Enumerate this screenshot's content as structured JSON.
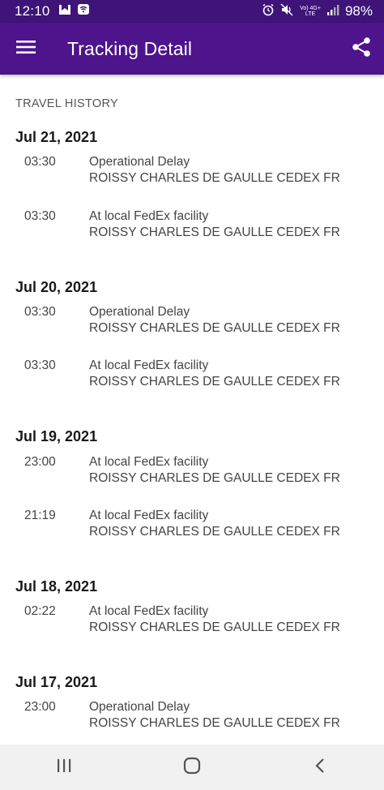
{
  "status_bar": {
    "time": "12:10",
    "network_label_top": "Vo) 4G+",
    "network_label_bottom": "LTE",
    "battery": "98%",
    "icons": [
      "mailbox-icon",
      "wifi-box-icon",
      "alarm-icon",
      "mute-icon",
      "signal-icon"
    ]
  },
  "app_bar": {
    "title": "Tracking Detail",
    "background": "#4d148c",
    "icons": [
      "menu-icon",
      "share-icon"
    ]
  },
  "travel_history": {
    "heading": "TRAVEL HISTORY",
    "days": [
      {
        "date": "Jul 21, 2021",
        "events": [
          {
            "time": "03:30",
            "status": "Operational Delay",
            "location": "ROISSY CHARLES DE GAULLE CEDEX FR"
          },
          {
            "time": "03:30",
            "status": "At local FedEx facility",
            "location": "ROISSY CHARLES DE GAULLE CEDEX FR"
          }
        ]
      },
      {
        "date": "Jul 20, 2021",
        "events": [
          {
            "time": "03:30",
            "status": "Operational Delay",
            "location": "ROISSY CHARLES DE GAULLE CEDEX FR"
          },
          {
            "time": "03:30",
            "status": "At local FedEx facility",
            "location": "ROISSY CHARLES DE GAULLE CEDEX FR"
          }
        ]
      },
      {
        "date": "Jul 19, 2021",
        "events": [
          {
            "time": "23:00",
            "status": "At local FedEx facility",
            "location": "ROISSY CHARLES DE GAULLE CEDEX FR"
          },
          {
            "time": "21:19",
            "status": "At local FedEx facility",
            "location": "ROISSY CHARLES DE GAULLE CEDEX FR"
          }
        ]
      },
      {
        "date": "Jul 18, 2021",
        "events": [
          {
            "time": "02:22",
            "status": "At local FedEx facility",
            "location": "ROISSY CHARLES DE GAULLE CEDEX FR"
          }
        ]
      },
      {
        "date": "Jul 17, 2021",
        "events": [
          {
            "time": "23:00",
            "status": "Operational Delay",
            "location": "ROISSY CHARLES DE GAULLE CEDEX FR"
          }
        ]
      }
    ]
  },
  "nav_bar": {
    "icons": [
      "recent-apps-icon",
      "home-icon",
      "back-icon"
    ]
  }
}
